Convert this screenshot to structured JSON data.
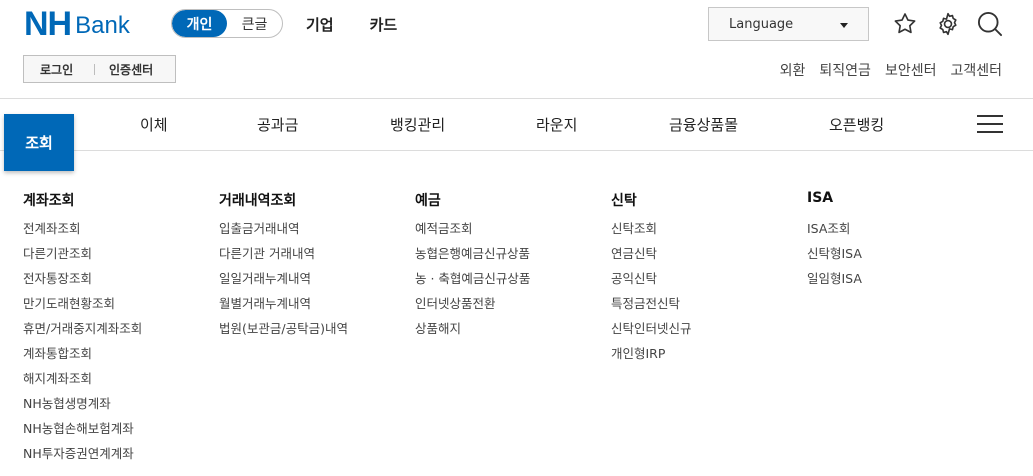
{
  "brand": {
    "nh": "NH",
    "bank": "Bank"
  },
  "segments": [
    {
      "label": "개인",
      "active": true
    },
    {
      "label": "큰글",
      "active": false
    }
  ],
  "top_nav": [
    "기업",
    "카드"
  ],
  "language": {
    "label": "Language"
  },
  "login": {
    "login_label": "로그인",
    "cert_label": "인증센터"
  },
  "util_nav": [
    "외환",
    "퇴직연금",
    "보안센터",
    "고객센터"
  ],
  "gnb": {
    "active": "조회",
    "items": [
      "이체",
      "공과금",
      "뱅킹관리",
      "라운지",
      "금융상품몰",
      "오픈뱅킹"
    ]
  },
  "menu_columns": [
    {
      "title": "계좌조회",
      "items": [
        "전계좌조회",
        "다른기관조회",
        "전자통장조회",
        "만기도래현황조회",
        "휴면/거래중지계좌조회",
        "계좌통합조회",
        "해지계좌조회",
        "NH농협생명계좌",
        "NH농협손해보험계좌",
        "NH투자증권연계계좌"
      ]
    },
    {
      "title": "거래내역조회",
      "items": [
        "입출금거래내역",
        "다른기관 거래내역",
        "일일거래누계내역",
        "월별거래누계내역",
        "법원(보관금/공탁금)내역"
      ]
    },
    {
      "title": "예금",
      "items": [
        "예적금조회",
        "농협은행예금신규상품",
        "농 · 축협예금신규상품",
        "인터넷상품전환",
        "상품해지"
      ]
    },
    {
      "title": "신탁",
      "items": [
        "신탁조회",
        "연금신탁",
        "공익신탁",
        "특정금전신탁",
        "신탁인터넷신규",
        "개인형IRP"
      ]
    },
    {
      "title": "ISA",
      "items": [
        "ISA조회",
        "신탁형ISA",
        "일임형ISA"
      ]
    }
  ],
  "colors": {
    "brand_blue": "#0068b7"
  }
}
